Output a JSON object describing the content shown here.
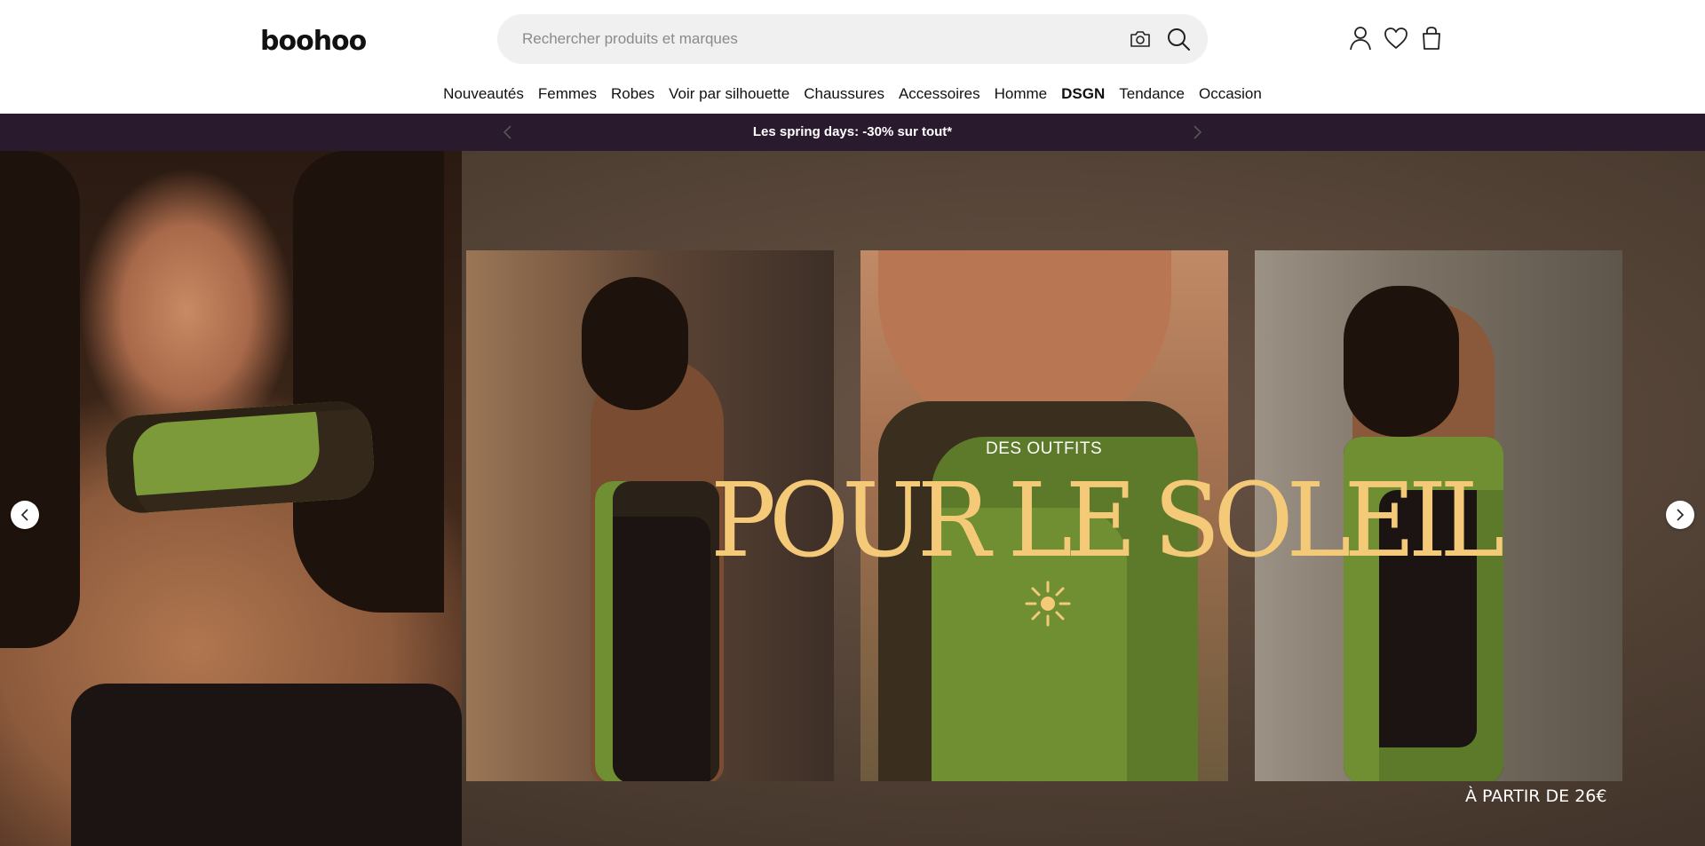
{
  "header": {
    "logo": "boohoo",
    "search": {
      "placeholder": "Rechercher produits et marques",
      "value": ""
    },
    "icons": [
      "camera-icon",
      "search-icon",
      "account-icon",
      "heart-icon",
      "bag-icon"
    ]
  },
  "nav": {
    "items": [
      {
        "label": "Nouveautés",
        "bold": false
      },
      {
        "label": "Femmes",
        "bold": false
      },
      {
        "label": "Robes",
        "bold": false
      },
      {
        "label": "Voir par silhouette",
        "bold": false
      },
      {
        "label": "Chaussures",
        "bold": false
      },
      {
        "label": "Accessoires",
        "bold": false
      },
      {
        "label": "Homme",
        "bold": false
      },
      {
        "label": "DSGN",
        "bold": true
      },
      {
        "label": "Tendance",
        "bold": false
      },
      {
        "label": "Occasion",
        "bold": false
      }
    ]
  },
  "promo": {
    "text": "Les spring days: -30% sur tout*",
    "background": "#2a1a2e"
  },
  "hero": {
    "subtitle": "DES OUTFITS",
    "title": "POUR LE SOLEIL",
    "price": "À PARTIR DE 26€",
    "title_color": "#f4c978"
  }
}
